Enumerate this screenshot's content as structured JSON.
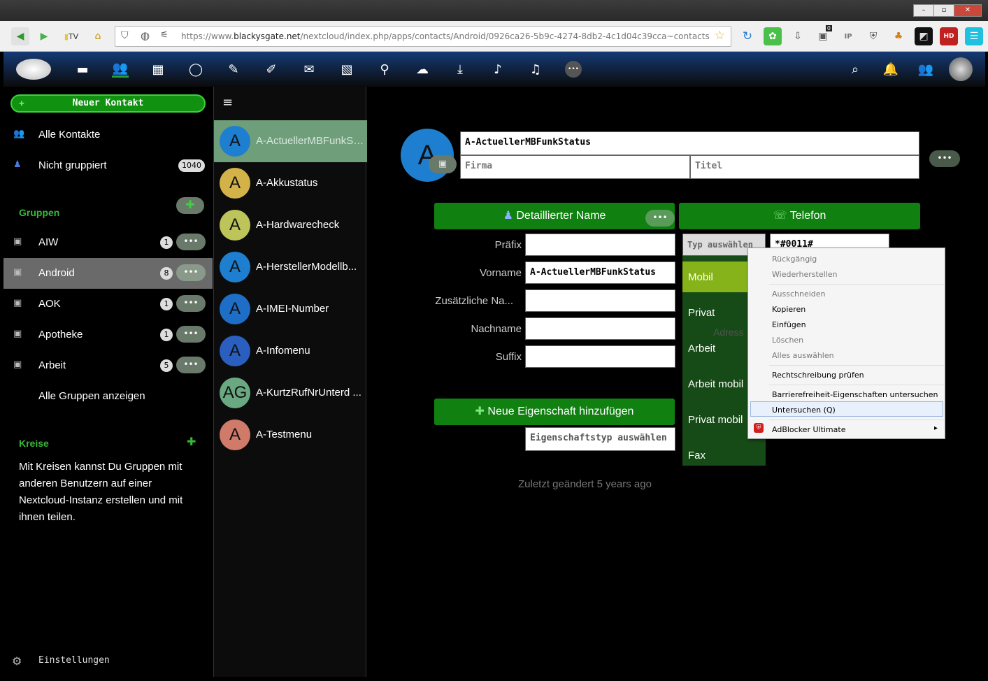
{
  "browser": {
    "window_buttons": [
      "–",
      "▫",
      "✕"
    ],
    "tv_label": "TV",
    "url_prefix": "https://www.",
    "url_domain": "blackysgate.net",
    "url_path": "/nextcloud/index.php/apps/contacts/Android/0926ca26-5b9c-4274-8db2-4c1d04c39cca~contacts",
    "badge_count": "0",
    "hd_label": "HD",
    "ip_label": "IP"
  },
  "sidebar": {
    "new_contact": "Neuer Kontakt",
    "all_contacts": "Alle Kontakte",
    "ungrouped": "Nicht gruppiert",
    "ungrouped_count": "1040",
    "groups_title": "Gruppen",
    "groups": [
      {
        "label": "AIW",
        "count": "1"
      },
      {
        "label": "Android",
        "count": "8"
      },
      {
        "label": "AOK",
        "count": "1"
      },
      {
        "label": "Apotheke",
        "count": "1"
      },
      {
        "label": "Arbeit",
        "count": "5"
      }
    ],
    "show_all_groups": "Alle Gruppen anzeigen",
    "circles_title": "Kreise",
    "circles_text": "Mit Kreisen kannst Du Gruppen mit anderen Benutzern auf einer Nextcloud-Instanz erstellen und mit ihnen teilen.",
    "settings": "Einstellungen",
    "more_glyph": "•••"
  },
  "contacts": [
    {
      "initial": "A",
      "name": "A-ActuellerMBFunkSt...",
      "color": "#1e7fd0"
    },
    {
      "initial": "A",
      "name": "A-Akkustatus",
      "color": "#d4b24a"
    },
    {
      "initial": "A",
      "name": "A-Hardwarecheck",
      "color": "#bcc45a"
    },
    {
      "initial": "A",
      "name": "A-HerstellerModellb...",
      "color": "#1e7fd0"
    },
    {
      "initial": "A",
      "name": "A-IMEI-Number",
      "color": "#1e6ec8"
    },
    {
      "initial": "A",
      "name": "A-Infomenu",
      "color": "#2a5fc0"
    },
    {
      "initial": "AG",
      "name": "A-KurtzRufNrUnterd ...",
      "color": "#6aa882"
    },
    {
      "initial": "A",
      "name": "A-Testmenu",
      "color": "#d07a6a"
    }
  ],
  "detail": {
    "avatar_initial": "A",
    "full_name": "A-ActuellerMBFunkStatus",
    "company_placeholder": "Firma",
    "title_placeholder": "Titel",
    "detailed_name": "Detaillierter Name",
    "phone": "Telefon",
    "labels": {
      "prefix": "Präfix",
      "firstname": "Vorname",
      "additional": "Zusätzliche Na...",
      "lastname": "Nachname",
      "suffix": "Suffix"
    },
    "firstname_value": "A-ActuellerMBFunkStatus",
    "type_select": "Typ auswählen",
    "phone_value": "*#0011#",
    "phone_types": [
      "Mobil",
      "Privat",
      "Arbeit",
      "Arbeit mobil",
      "Privat mobil",
      "Fax"
    ],
    "address_ghost": "Adress",
    "add_property": "Neue Eigenschaft hinzufügen",
    "property_type_placeholder": "Eigenschaftstyp auswählen",
    "last_modified": "Zuletzt geändert 5 years ago"
  },
  "context_menu": {
    "undo": "Rückgängig",
    "redo": "Wiederherstellen",
    "cut": "Ausschneiden",
    "copy": "Kopieren",
    "paste": "Einfügen",
    "delete": "Löschen",
    "select_all": "Alles auswählen",
    "spellcheck": "Rechtschreibung prüfen",
    "accessibility": "Barrierefreiheit-Eigenschaften untersuchen",
    "inspect": "Untersuchen (Q)",
    "adblocker": "AdBlocker Ultimate"
  }
}
